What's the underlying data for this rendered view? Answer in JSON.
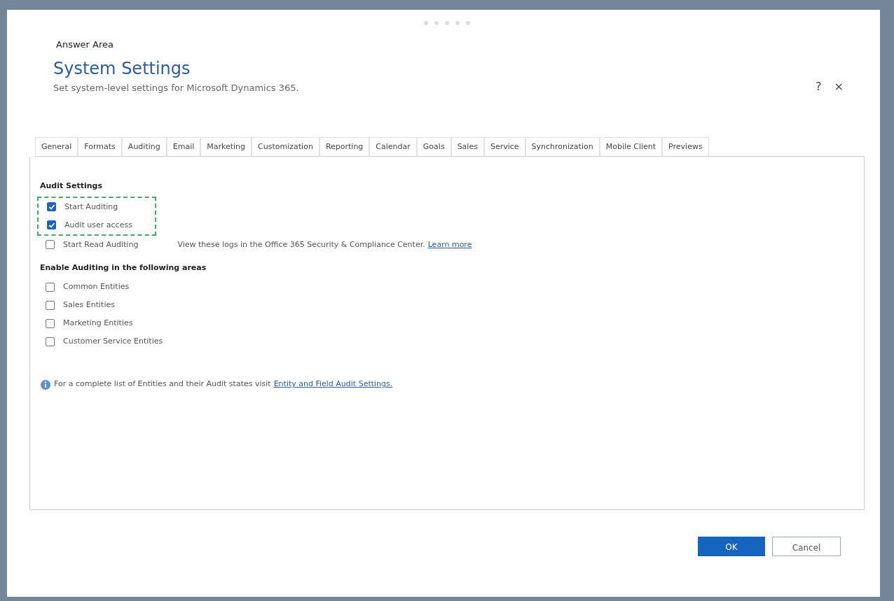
{
  "header": {
    "label": "Answer Area",
    "title": "System Settings",
    "subtitle": "Set system-level settings for Microsoft Dynamics 365.",
    "help": "?",
    "close": "×"
  },
  "tabs": [
    {
      "label": "General"
    },
    {
      "label": "Formats"
    },
    {
      "label": "Auditing"
    },
    {
      "label": "Email"
    },
    {
      "label": "Marketing"
    },
    {
      "label": "Customization"
    },
    {
      "label": "Reporting"
    },
    {
      "label": "Calendar"
    },
    {
      "label": "Goals"
    },
    {
      "label": "Sales"
    },
    {
      "label": "Service"
    },
    {
      "label": "Synchronization"
    },
    {
      "label": "Mobile Client"
    },
    {
      "label": "Previews"
    }
  ],
  "audit_settings": {
    "heading": "Audit Settings",
    "items": [
      {
        "label": "Start Auditing",
        "checked": true,
        "highlighted": true
      },
      {
        "label": "Audit user access",
        "checked": true,
        "highlighted": true
      },
      {
        "label": "Start Read Auditing",
        "checked": false,
        "highlighted": false,
        "note": "View these logs in the Office 365 Security & Compliance Center.",
        "link": "Learn more"
      }
    ]
  },
  "areas": {
    "heading": "Enable Auditing in the following areas",
    "items": [
      {
        "label": "Common Entities",
        "checked": false
      },
      {
        "label": "Sales Entities",
        "checked": false
      },
      {
        "label": "Marketing Entities",
        "checked": false
      },
      {
        "label": "Customer Service Entities",
        "checked": false
      }
    ]
  },
  "info": {
    "text": "For a complete list of Entities and their Audit states visit",
    "link": "Entity and Field Audit Settings."
  },
  "buttons": [
    {
      "label": "OK",
      "kind": "primary"
    },
    {
      "label": "Cancel",
      "kind": "secondary"
    }
  ]
}
